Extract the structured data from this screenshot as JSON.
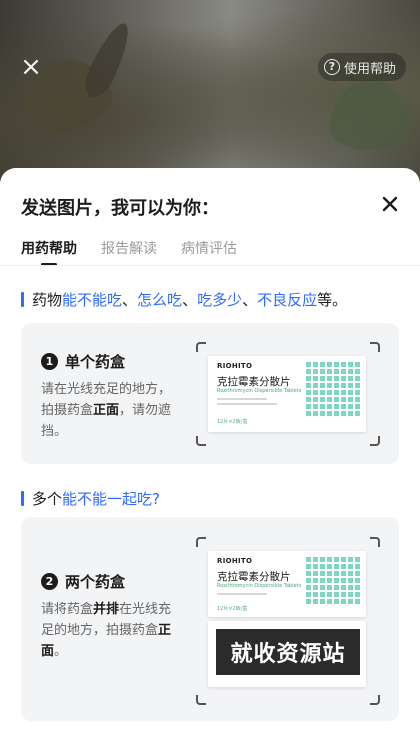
{
  "camera": {
    "help_label": "使用帮助",
    "help_icon": "?",
    "close_icon": "×"
  },
  "sheet": {
    "title": "发送图片，我可以为你：",
    "tabs": [
      "用药帮助",
      "报告解读",
      "病情评估"
    ],
    "active_tab": 0
  },
  "section1": {
    "prefix": "药物",
    "q1": "能不能吃",
    "sep1": "、",
    "q2": "怎么吃",
    "sep2": "、",
    "q3": "吃多少",
    "sep3": "、",
    "q4": "不良反应",
    "suffix": "等。"
  },
  "card1": {
    "num": "1",
    "title": "单个药盒",
    "desc_a": "请在光线充足的地方，拍摄药盒",
    "desc_bold": "正面",
    "desc_b": "，请勿遮挡。"
  },
  "section2": {
    "prefix": "多个",
    "q": "能不能一起吃?"
  },
  "card2": {
    "num": "2",
    "title": "两个药盒",
    "desc_a": "请将药盒",
    "desc_bold1": "并排",
    "desc_b": "在光线充足的地方，拍摄药盒",
    "desc_bold2": "正面",
    "desc_c": "。"
  },
  "box": {
    "brand": "RIOHITO",
    "drug_name": "克拉霉素分散片",
    "english": "Roxithromycin Dispersible Tablets",
    "spec": "12片×2板/盒"
  },
  "watermark": "就收资源站",
  "colors": {
    "accent": "#2f6bff",
    "teal": "#7fd6c2"
  }
}
